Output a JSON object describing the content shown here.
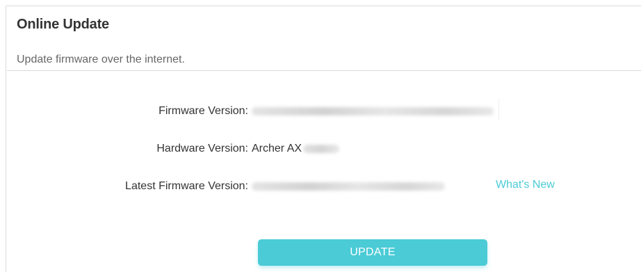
{
  "section": {
    "title": "Online Update",
    "description": "Update firmware over the internet."
  },
  "firmware": {
    "firmware_version_label": "Firmware Version:",
    "hardware_version_label": "Hardware Version:",
    "hardware_version_value": "Archer AX",
    "latest_version_label": "Latest Firmware Version:",
    "whats_new_link": "What's New"
  },
  "actions": {
    "update_label": "UPDATE"
  },
  "colors": {
    "accent": "#4acbd6",
    "title_text": "#333333",
    "muted_text": "#666666"
  }
}
